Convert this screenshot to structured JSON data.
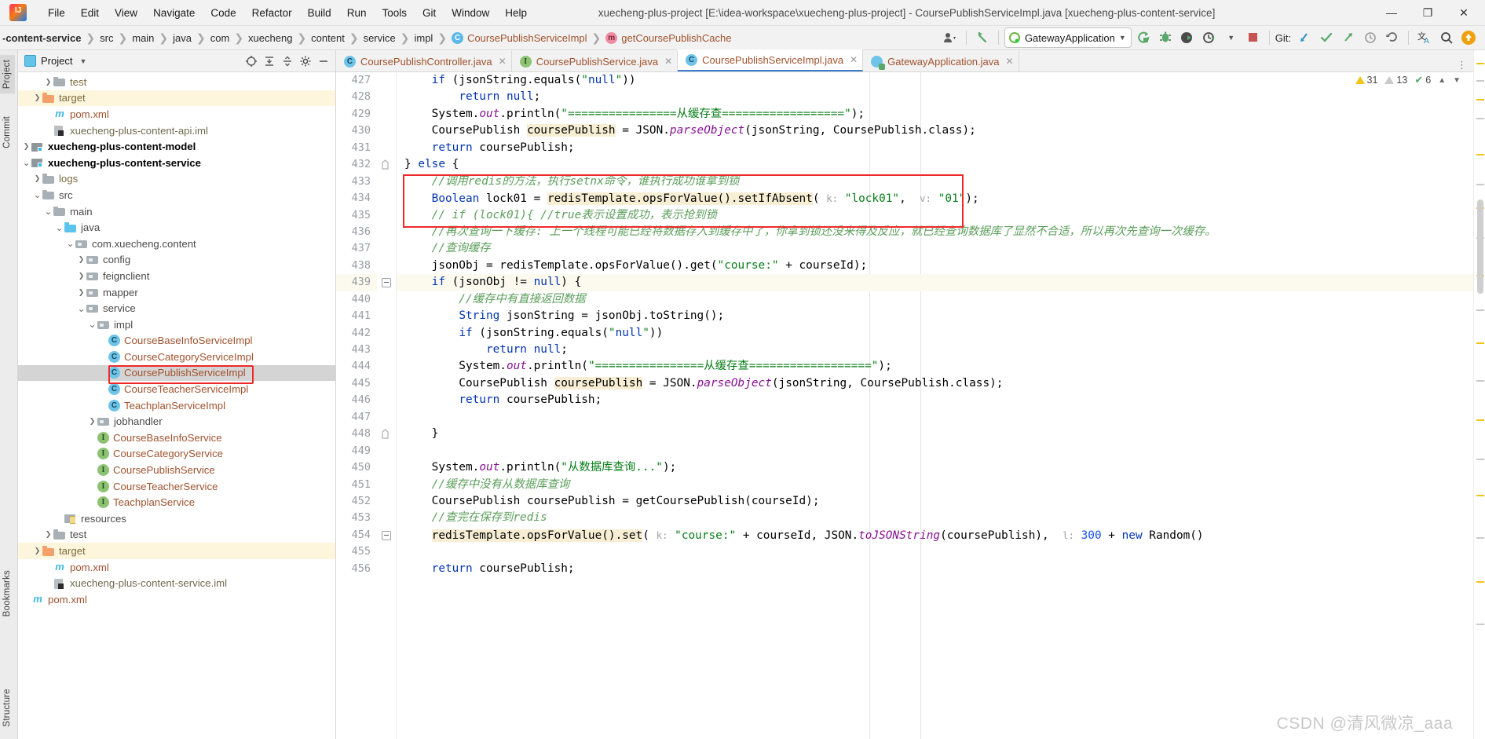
{
  "window": {
    "title": "xuecheng-plus-project [E:\\idea-workspace\\xuecheng-plus-project] - CoursePublishServiceImpl.java [xuecheng-plus-content-service]",
    "minimize": "—",
    "maximize": "❐",
    "close": "✕"
  },
  "menu": [
    {
      "label": "File"
    },
    {
      "label": "Edit"
    },
    {
      "label": "View"
    },
    {
      "label": "Navigate"
    },
    {
      "label": "Code"
    },
    {
      "label": "Refactor"
    },
    {
      "label": "Build"
    },
    {
      "label": "Run"
    },
    {
      "label": "Tools"
    },
    {
      "label": "Git"
    },
    {
      "label": "Window"
    },
    {
      "label": "Help"
    }
  ],
  "breadcrumb": [
    {
      "label": "-content-service",
      "style": "bold"
    },
    {
      "label": "src",
      "style": "dir"
    },
    {
      "label": "main",
      "style": "dir"
    },
    {
      "label": "java",
      "style": "dir"
    },
    {
      "label": "com",
      "style": "dir"
    },
    {
      "label": "xuecheng",
      "style": "dir"
    },
    {
      "label": "content",
      "style": "dir"
    },
    {
      "label": "service",
      "style": "dir"
    },
    {
      "label": "impl",
      "style": "dir"
    },
    {
      "label": "CoursePublishServiceImpl",
      "style": "class",
      "icon": "C"
    },
    {
      "label": "getCoursePublishCache",
      "style": "method",
      "icon": "m"
    }
  ],
  "toolbar": {
    "run_config": "GatewayApplication",
    "git_label": "Git:",
    "icons": [
      "user-icon",
      "back-arrow-icon",
      "run-icon",
      "debug-icon",
      "run-with-coverage-icon",
      "profiler-icon",
      "stop-icon",
      "git-update-icon",
      "git-commit-icon",
      "git-push-icon",
      "git-history-icon",
      "git-rollback-icon",
      "translate-icon",
      "search-icon",
      "updates-icon"
    ]
  },
  "sidebar": {
    "vertical_tabs": [
      {
        "label": "Project",
        "selected": true
      },
      {
        "label": "Commit",
        "selected": false
      },
      {
        "label": "Bookmarks",
        "selected": false
      },
      {
        "label": "Structure",
        "selected": false
      }
    ],
    "panel_title": "Project",
    "tree": [
      {
        "label": "test",
        "indent": 5,
        "arrow": "right",
        "icon": "folder-gray",
        "style": "dirtan"
      },
      {
        "label": "target",
        "indent": 4,
        "arrow": "right",
        "icon": "folder-orange",
        "style": "dirtan",
        "highlight": "yellow"
      },
      {
        "label": "pom.xml",
        "indent": 5,
        "arrow": "none",
        "icon": "maven-m",
        "style": "file"
      },
      {
        "label": "xuecheng-plus-content-api.iml",
        "indent": 5,
        "arrow": "none",
        "icon": "iml",
        "style": "iml"
      },
      {
        "label": "xuecheng-plus-content-model",
        "indent": 3,
        "arrow": "right",
        "icon": "module",
        "style": "bold"
      },
      {
        "label": "xuecheng-plus-content-service",
        "indent": 3,
        "arrow": "down",
        "icon": "module",
        "style": "bold"
      },
      {
        "label": "logs",
        "indent": 4,
        "arrow": "right",
        "icon": "folder-gray",
        "style": "dirtan"
      },
      {
        "label": "src",
        "indent": 4,
        "arrow": "down",
        "icon": "folder-gray",
        "style": "dir"
      },
      {
        "label": "main",
        "indent": 5,
        "arrow": "down",
        "icon": "folder-gray",
        "style": "dir"
      },
      {
        "label": "java",
        "indent": 6,
        "arrow": "down",
        "icon": "folder-blue",
        "style": "dir"
      },
      {
        "label": "com.xuecheng.content",
        "indent": 7,
        "arrow": "down",
        "icon": "package",
        "style": "dir"
      },
      {
        "label": "config",
        "indent": 8,
        "arrow": "right",
        "icon": "package",
        "style": "dir"
      },
      {
        "label": "feignclient",
        "indent": 8,
        "arrow": "right",
        "icon": "package",
        "style": "dir"
      },
      {
        "label": "mapper",
        "indent": 8,
        "arrow": "right",
        "icon": "package",
        "style": "dir"
      },
      {
        "label": "service",
        "indent": 8,
        "arrow": "down",
        "icon": "package",
        "style": "dir"
      },
      {
        "label": "impl",
        "indent": 9,
        "arrow": "down",
        "icon": "package",
        "style": "dir"
      },
      {
        "label": "CourseBaseInfoServiceImpl",
        "indent": 10,
        "arrow": "none",
        "icon": "class",
        "style": "file"
      },
      {
        "label": "CourseCategoryServiceImpl",
        "indent": 10,
        "arrow": "none",
        "icon": "class",
        "style": "file"
      },
      {
        "label": "CoursePublishServiceImpl",
        "indent": 10,
        "arrow": "none",
        "icon": "class",
        "style": "file",
        "selected": true,
        "boxed": true
      },
      {
        "label": "CourseTeacherServiceImpl",
        "indent": 10,
        "arrow": "none",
        "icon": "class",
        "style": "file"
      },
      {
        "label": "TeachplanServiceImpl",
        "indent": 10,
        "arrow": "none",
        "icon": "class",
        "style": "file"
      },
      {
        "label": "jobhandler",
        "indent": 9,
        "arrow": "right",
        "icon": "package",
        "style": "dir"
      },
      {
        "label": "CourseBaseInfoService",
        "indent": 9,
        "arrow": "none",
        "icon": "interface",
        "style": "file"
      },
      {
        "label": "CourseCategoryService",
        "indent": 9,
        "arrow": "none",
        "icon": "interface",
        "style": "file"
      },
      {
        "label": "CoursePublishService",
        "indent": 9,
        "arrow": "none",
        "icon": "interface",
        "style": "file"
      },
      {
        "label": "CourseTeacherService",
        "indent": 9,
        "arrow": "none",
        "icon": "interface",
        "style": "file"
      },
      {
        "label": "TeachplanService",
        "indent": 9,
        "arrow": "none",
        "icon": "interface",
        "style": "file"
      },
      {
        "label": "resources",
        "indent": 6,
        "arrow": "none",
        "icon": "resources",
        "style": "dir"
      },
      {
        "label": "test",
        "indent": 5,
        "arrow": "right",
        "icon": "folder-gray",
        "style": "dir"
      },
      {
        "label": "target",
        "indent": 4,
        "arrow": "right",
        "icon": "folder-orange",
        "style": "dirtan",
        "highlight": "yellow"
      },
      {
        "label": "pom.xml",
        "indent": 5,
        "arrow": "none",
        "icon": "maven-m",
        "style": "file"
      },
      {
        "label": "xuecheng-plus-content-service.iml",
        "indent": 5,
        "arrow": "none",
        "icon": "iml",
        "style": "iml"
      },
      {
        "label": "pom.xml",
        "indent": 3,
        "arrow": "none",
        "icon": "maven-m",
        "style": "file"
      }
    ]
  },
  "editor": {
    "tabs": [
      {
        "label": "CoursePublishController.java",
        "icon": "C",
        "icon_type": "class",
        "active": false
      },
      {
        "label": "CoursePublishService.java",
        "icon": "I",
        "icon_type": "interface",
        "active": false
      },
      {
        "label": "CoursePublishServiceImpl.java",
        "icon": "C",
        "icon_type": "class",
        "active": true
      },
      {
        "label": "GatewayApplication.java",
        "icon": "C",
        "icon_type": "run-class",
        "active": false
      }
    ],
    "inspections": {
      "warnings": "31",
      "weak_warnings": "13",
      "checks": "6"
    },
    "first_line": 427,
    "current_line": 439,
    "lines": [
      {
        "n": 427,
        "text": "    if (jsonString.equals(\"null\"))"
      },
      {
        "n": 428,
        "text": "        return null;"
      },
      {
        "n": 429,
        "text": "    System.out.println(\"================从缓存查==================\");"
      },
      {
        "n": 430,
        "text": "    CoursePublish coursePublish = JSON.parseObject(jsonString, CoursePublish.class);"
      },
      {
        "n": 431,
        "text": "    return coursePublish;"
      },
      {
        "n": 432,
        "text": "} else {"
      },
      {
        "n": 433,
        "text": "    //调用redis的方法，执行setnx命令，谁执行成功谁拿到锁"
      },
      {
        "n": 434,
        "text": "    Boolean lock01 = redisTemplate.opsForValue().setIfAbsent( k: \"lock01\",  v: \"01\");"
      },
      {
        "n": 435,
        "text": "    // if (lock01){ //true表示设置成功，表示抢到锁"
      },
      {
        "n": 436,
        "text": "    //再次查询一下缓存: 上一个线程可能已经将数据存入到缓存中了，你拿到锁还没来得及反应，就已经查询数据库了显然不合适，所以再次先查询一次缓存。"
      },
      {
        "n": 437,
        "text": "    //查询缓存"
      },
      {
        "n": 438,
        "text": "    jsonObj = redisTemplate.opsForValue().get(\"course:\" + courseId);"
      },
      {
        "n": 439,
        "text": "    if (jsonObj != null) {"
      },
      {
        "n": 440,
        "text": "        //缓存中有直接返回数据"
      },
      {
        "n": 441,
        "text": "        String jsonString = jsonObj.toString();"
      },
      {
        "n": 442,
        "text": "        if (jsonString.equals(\"null\"))"
      },
      {
        "n": 443,
        "text": "            return null;"
      },
      {
        "n": 444,
        "text": "        System.out.println(\"================从缓存查==================\");"
      },
      {
        "n": 445,
        "text": "        CoursePublish coursePublish = JSON.parseObject(jsonString, CoursePublish.class);"
      },
      {
        "n": 446,
        "text": "        return coursePublish;"
      },
      {
        "n": 447,
        "text": ""
      },
      {
        "n": 448,
        "text": "    }"
      },
      {
        "n": 449,
        "text": ""
      },
      {
        "n": 450,
        "text": "    System.out.println(\"从数据库查询...\");"
      },
      {
        "n": 451,
        "text": "    //缓存中没有从数据库查询"
      },
      {
        "n": 452,
        "text": "    CoursePublish coursePublish = getCoursePublish(courseId);"
      },
      {
        "n": 453,
        "text": "    //查完在保存到redis"
      },
      {
        "n": 454,
        "text": "    redisTemplate.opsForValue().set( k: \"course:\" + courseId, JSON.toJSONString(coursePublish),  l: 300 + new Random()"
      },
      {
        "n": 455,
        "text": ""
      },
      {
        "n": 456,
        "text": "    return coursePublish;"
      }
    ],
    "parameter_hints": [
      "k:",
      "v:",
      "l:"
    ]
  },
  "watermark": "CSDN @清风微凉_aaa",
  "colors": {
    "keyword": "#0033b3",
    "string": "#067d17",
    "comment": "#8c8c8c",
    "comment_green": "#5a9e5a",
    "field": "#871094",
    "number": "#1750eb",
    "accent_red": "#ef2929",
    "selection": "#d4d4d4",
    "highlight_yellow": "#fdf6dd",
    "tab_active_underline": "#3d7ecc"
  }
}
